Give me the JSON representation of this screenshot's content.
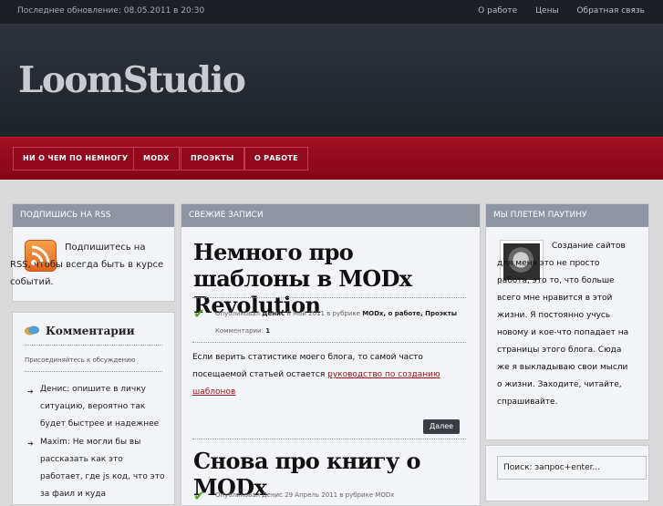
{
  "topbar": {
    "updated": "Последнее обновление: 08.05.2011 в 20:30",
    "links": [
      "О работе",
      "Цены",
      "Обратная связь"
    ]
  },
  "logo": "LoomStudio",
  "nav": [
    "НИ О ЧЕМ ПО НЕМНОГУ",
    "MODX",
    "ПРОЭКТЫ",
    "О РАБОТЕ"
  ],
  "left": {
    "rss_title": "ПОДПИШИСЬ НА RSS",
    "rss_text": "Подпишитесь на RSS, чтобы всегда быть в курсе событий.",
    "comments_title": "Комментарии",
    "comments_sub": "Присоединяйтесь к обсуждению",
    "comments": [
      {
        "text": "Денис: опишите в личку ситуацию, вероятно так будет быстрее и надежнее"
      },
      {
        "text": "Maxim: Не могли бы вы рассказать как это работает, где js код, что это за фаил и куда"
      }
    ]
  },
  "center": {
    "title": "СВЕЖИЕ ЗАПИСИ",
    "post1": {
      "title": "Немного про шаблоны в MODx Revolution",
      "meta_prefix": "Опубликовал",
      "author": "Денис",
      "date": "8 Май 2011",
      "rubric_prefix": "в рубрике",
      "categories": "MODx, о работе, Проэкты",
      "comments_label": "Комментарии:",
      "comments_count": "1",
      "excerpt": "Если верить статистике моего блога, то самой часто посещаемой статьей остается",
      "link": "руководство по созданию шаблонов"
    },
    "more": "Далее",
    "post2": {
      "title": "Снова про книгу о MODx",
      "meta": "Опубликовал Денис 29 Апрель 2011 в рубрике MODx"
    }
  },
  "right": {
    "title": "МЫ ПЛЕТЕМ ПАУТИНУ",
    "about": "Создание сайтов для меня это не просто работа, это то, что больше всего мне нравится в этой жизни. Я постоянно учусь новому и кое-что попадает на страницы этого блога. Сюда же я выкладываю свои мысли о жизни. Заходите, читайте, спрашивайте.",
    "search_placeholder": "Поиск: запрос+enter..."
  },
  "colors": {
    "accent": "#9b0c21",
    "header_bg": "#252931",
    "link": "#a4131f"
  }
}
